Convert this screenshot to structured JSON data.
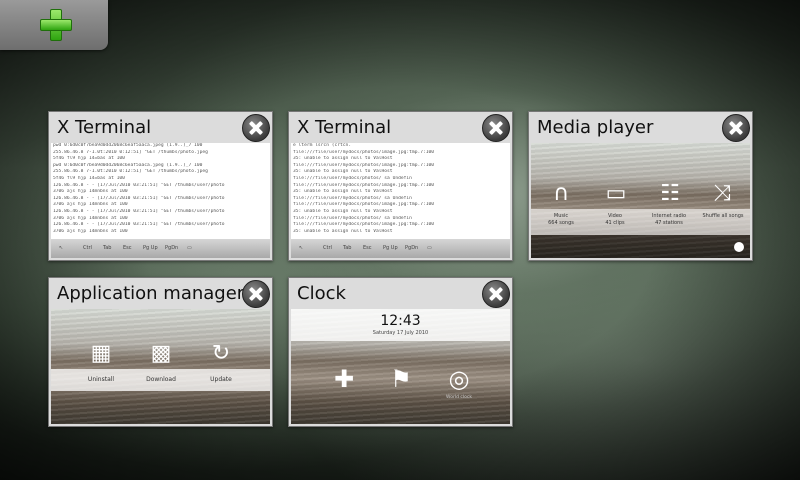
{
  "toolbar": {
    "add_icon": "plus-icon",
    "accent": "#3fb51a"
  },
  "windows": [
    {
      "title": "X Terminal"
    },
    {
      "title": "X Terminal"
    },
    {
      "title": "Media player"
    },
    {
      "title": "Application manager"
    },
    {
      "title": "Clock"
    }
  ],
  "terminal1": {
    "lines": [
      "pwd 0:6d0c0f7bea9d0dd2068c6eaf5aaca.jpeg (1.9..)_7 100",
      "255.86.46.8 7-1.0t:2010 0:12:51] \"GET /thumbs/photo.jpeg",
      "5f46 fl9 hjp 14=bas at 100",
      "pwd 0:6d0c0f7bea9d0dd2068c6eaf5aaca.jpeg (1.9..)_7 100",
      "255.86.46.8 7-1.0t:2010 0:12:51] \"GET /thumbs/photo.jpeg",
      "5f46 fl9 hjp 14=bas at 100",
      "126.86.46.8 - - [17/Jul/2010 03:21:51] \"GET /thumbs/user/photo",
      "3706 ajs hjp 14mnbns at 100",
      "126.86.46.8 - - [17/Jul/2010 03:21:51] \"GET /thumbs/user/photo",
      "3706 ajs hjp 14mnbns at 100",
      "126.86.46.8 - - [17/Jul/2010 03:21:51] \"GET /thumbs/user/photo",
      "3706 ajs hjp 14mnbns at 100",
      "126.86.46.8 - - [17/Jul/2010 03:21:51] \"GET /thumbs/user/photo",
      "3706 ajs hjp 14mnbns at 100"
    ],
    "keys": [
      "Ctrl",
      "Tab",
      "Esc",
      "Pg Up",
      "PgDn"
    ]
  },
  "terminal2": {
    "lines": [
      "e lterm lsrcn (crtcn.",
      "file:///file/user/mydocs/photos/image.jpg:tmp.7:100",
      "35: unable to assign null to ValHost",
      "file:///file/user/mydocs/photos/image.jpg:tmp.7:100",
      "35: unable to assign null to ValHost",
      "file:///file/user/mydocs/photos/ sa Undefin",
      "file:///file/user/mydocs/photos/image.jpg:tmp.7:100",
      "35: unable to assign null to ValHost",
      "file:///file/user/mydocs/photos/ sa Undefin",
      "file:///file/user/mydocs/photos/image.jpg:tmp.7:100",
      "35: unable to assign null to ValHost",
      "file:///file/user/mydocs/photos/ sa Undefin",
      "file:///file/user/mydocs/photos/image.jpg:tmp.7:100",
      "35: unable to assign null to ValHost"
    ],
    "keys": [
      "Ctrl",
      "Tab",
      "Esc",
      "Pg Up",
      "PgDn"
    ]
  },
  "media": {
    "items": [
      {
        "label": "Music",
        "sub": "664 songs"
      },
      {
        "label": "Video",
        "sub": "41 clips"
      },
      {
        "label": "Internet radio",
        "sub": "47 stations"
      },
      {
        "label": "Shuffle all songs",
        "sub": ""
      }
    ]
  },
  "appmgr": {
    "items": [
      "Uninstall",
      "Download",
      "Update"
    ]
  },
  "clock": {
    "time": "12:43",
    "date": "Saturday 17 July 2010",
    "subs": [
      "",
      "",
      "World clock"
    ]
  }
}
